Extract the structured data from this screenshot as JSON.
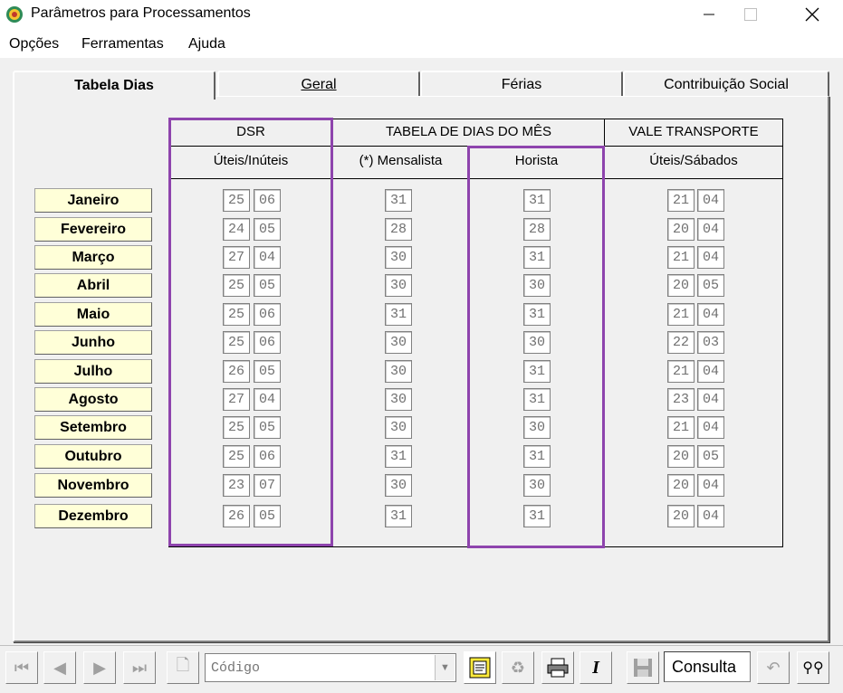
{
  "window": {
    "title": "Parâmetros para Processamentos"
  },
  "menu": [
    "Opções",
    "Ferramentas",
    "Ajuda"
  ],
  "tabs": [
    {
      "label": "Tabela Dias",
      "active": true
    },
    {
      "label": "Geral",
      "active": false
    },
    {
      "label": "Férias",
      "active": false
    },
    {
      "label": "Contribuição Social",
      "active": false
    }
  ],
  "table": {
    "group_headers": {
      "dsr": "DSR",
      "tabela": "TABELA DE DIAS DO MÊS",
      "vale": "VALE TRANSPORTE"
    },
    "sub_headers": {
      "dsr": "Úteis/Inúteis",
      "mensalista": "(*) Mensalista",
      "horista": "Horista",
      "vale": "Úteis/Sábados"
    },
    "rows": [
      {
        "month": "Janeiro",
        "dsr": [
          "25",
          "06"
        ],
        "mensalista": "31",
        "horista": "31",
        "vale": [
          "21",
          "04"
        ]
      },
      {
        "month": "Fevereiro",
        "dsr": [
          "24",
          "05"
        ],
        "mensalista": "28",
        "horista": "28",
        "vale": [
          "20",
          "04"
        ]
      },
      {
        "month": "Março",
        "dsr": [
          "27",
          "04"
        ],
        "mensalista": "30",
        "horista": "31",
        "vale": [
          "21",
          "04"
        ]
      },
      {
        "month": "Abril",
        "dsr": [
          "25",
          "05"
        ],
        "mensalista": "30",
        "horista": "30",
        "vale": [
          "20",
          "05"
        ]
      },
      {
        "month": "Maio",
        "dsr": [
          "25",
          "06"
        ],
        "mensalista": "31",
        "horista": "31",
        "vale": [
          "21",
          "04"
        ]
      },
      {
        "month": "Junho",
        "dsr": [
          "25",
          "06"
        ],
        "mensalista": "30",
        "horista": "30",
        "vale": [
          "22",
          "03"
        ]
      },
      {
        "month": "Julho",
        "dsr": [
          "26",
          "05"
        ],
        "mensalista": "30",
        "horista": "31",
        "vale": [
          "21",
          "04"
        ]
      },
      {
        "month": "Agosto",
        "dsr": [
          "27",
          "04"
        ],
        "mensalista": "30",
        "horista": "31",
        "vale": [
          "23",
          "04"
        ]
      },
      {
        "month": "Setembro",
        "dsr": [
          "25",
          "05"
        ],
        "mensalista": "30",
        "horista": "30",
        "vale": [
          "21",
          "04"
        ]
      },
      {
        "month": "Outubro",
        "dsr": [
          "25",
          "06"
        ],
        "mensalista": "31",
        "horista": "31",
        "vale": [
          "20",
          "05"
        ]
      },
      {
        "month": "Novembro",
        "dsr": [
          "23",
          "07"
        ],
        "mensalista": "30",
        "horista": "30",
        "vale": [
          "20",
          "04"
        ]
      },
      {
        "month": "Dezembro",
        "dsr": [
          "26",
          "05"
        ],
        "mensalista": "31",
        "horista": "31",
        "vale": [
          "20",
          "04"
        ]
      }
    ]
  },
  "toolbar": {
    "codigo_placeholder": "Código",
    "consulta_value": "Consulta"
  },
  "icons": {
    "first": "first-record-icon",
    "prev": "previous-record-icon",
    "next": "next-record-icon",
    "last": "last-record-icon",
    "new": "new-document-icon",
    "report": "report-icon",
    "recycle": "recycle-icon",
    "print": "printer-icon",
    "italic": "italic-icon",
    "save": "save-icon",
    "undo": "undo-icon",
    "find": "binoculars-icon"
  },
  "colors": {
    "highlight": "#8e44ad",
    "month_bg": "#ffffd8"
  }
}
